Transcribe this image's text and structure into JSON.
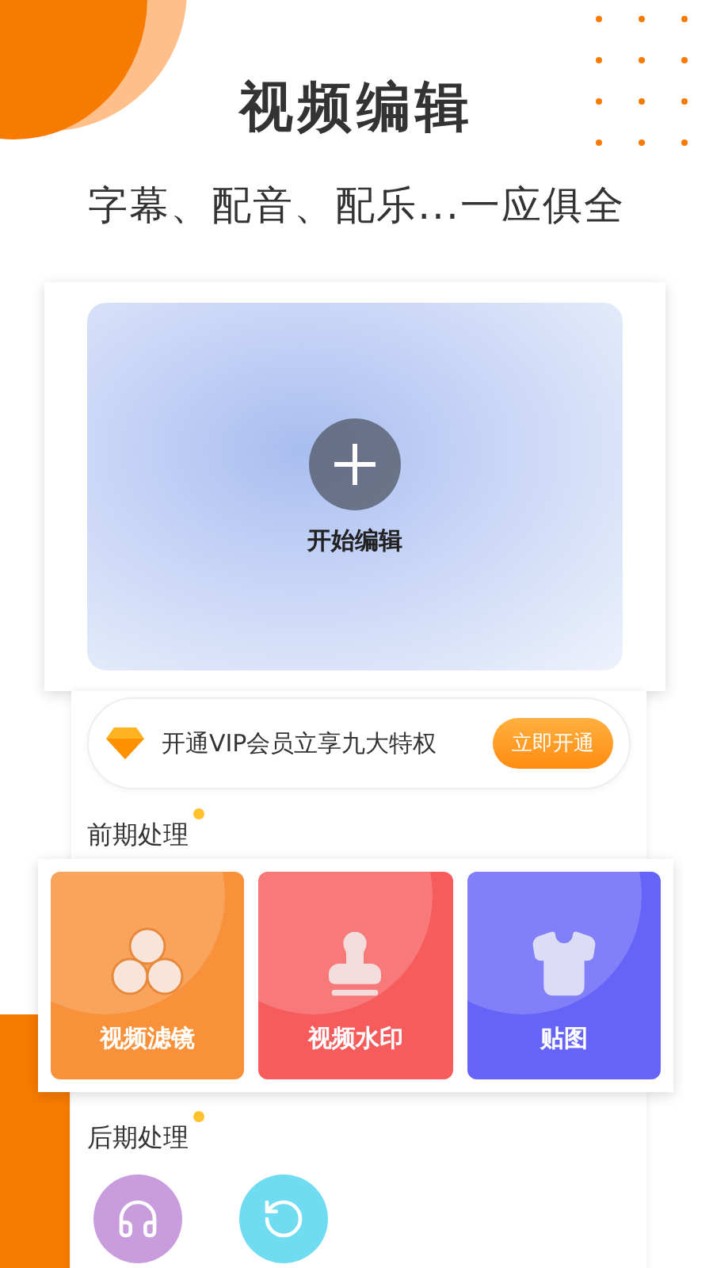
{
  "header": {
    "title": "视频编辑",
    "subtitle": "字幕、配音、配乐...一应俱全"
  },
  "editor": {
    "label": "开始编辑"
  },
  "vip": {
    "text": "开通VIP会员立享九大特权",
    "button": "立即开通"
  },
  "sections": [
    {
      "title": "前期处理",
      "tools": [
        {
          "kind": "filter",
          "label": "视频滤镜",
          "color": "#f8913a"
        },
        {
          "kind": "stamp",
          "label": "视频水印",
          "color": "#f65c5c"
        },
        {
          "kind": "shirt",
          "label": "贴图",
          "color": "#6664f8"
        }
      ]
    },
    {
      "title": "后期处理",
      "tools": [
        {
          "kind": "headphones",
          "color": "#c99ddd"
        },
        {
          "kind": "rotate",
          "color": "#6fdcf2"
        }
      ]
    }
  ]
}
